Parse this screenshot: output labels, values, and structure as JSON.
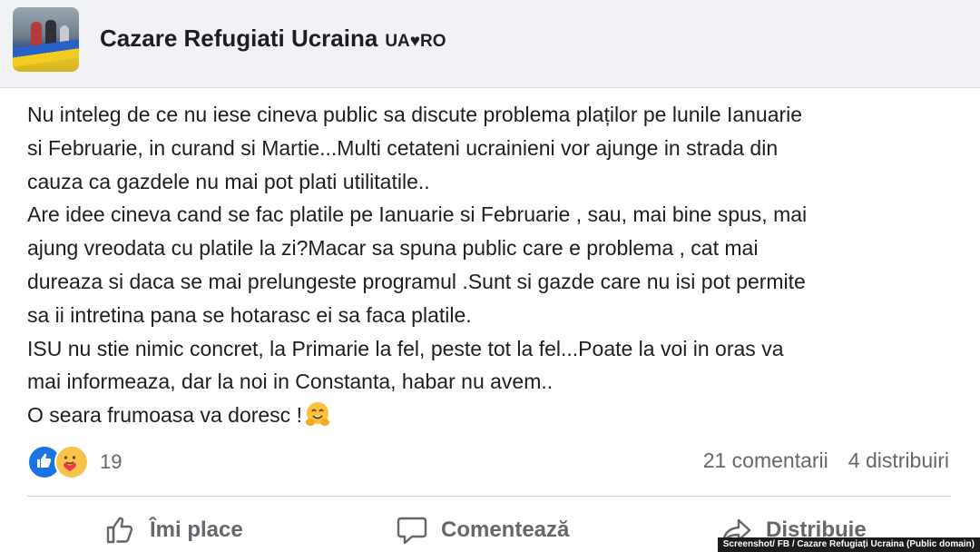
{
  "page": {
    "name": "Cazare Refugiati Ucraina",
    "tag": "UA♥RO"
  },
  "post": {
    "lines": [
      "Nu inteleg de ce nu iese cineva public sa discute problema plaților pe lunile Ianuarie",
      "si Februarie, in curand si Martie...Multi cetateni ucrainieni vor ajunge in strada din",
      "cauza ca gazdele nu mai pot plati utilitatile..",
      "Are idee cineva cand se fac platile pe Ianuarie si Februarie , sau, mai bine spus, mai",
      "ajung vreodata cu platile la zi?Macar sa spuna public care e problema , cat mai",
      "dureaza si daca se mai prelungeste programul .Sunt si gazde care nu isi pot permite",
      "sa ii intretina pana se hotarasc ei sa faca platile.",
      "ISU nu stie nimic concret, la Primarie la fel, peste tot la fel...Poate la voi in oras va",
      "mai informeaza, dar la noi in Constanta, habar nu avem..",
      "O seara frumoasa va doresc !"
    ],
    "closing_emoji": "hugging-face-emoji"
  },
  "reactions": {
    "icons": [
      "like-reaction-icon",
      "care-reaction-icon"
    ],
    "count": "19"
  },
  "stats": {
    "comments": "21 comentarii",
    "shares": "4 distribuiri"
  },
  "actions": {
    "like_label": "Îmi place",
    "comment_label": "Comentează",
    "share_label": "Distribuie"
  },
  "credit": "Screenshot/ FB / Cazare Refugiați Ucraina (Public domain)",
  "colors": {
    "like_blue": "#1b74e4",
    "care_yellow": "#f7c34a",
    "muted_text": "#65676b",
    "header_bg": "#f0f2f5"
  }
}
